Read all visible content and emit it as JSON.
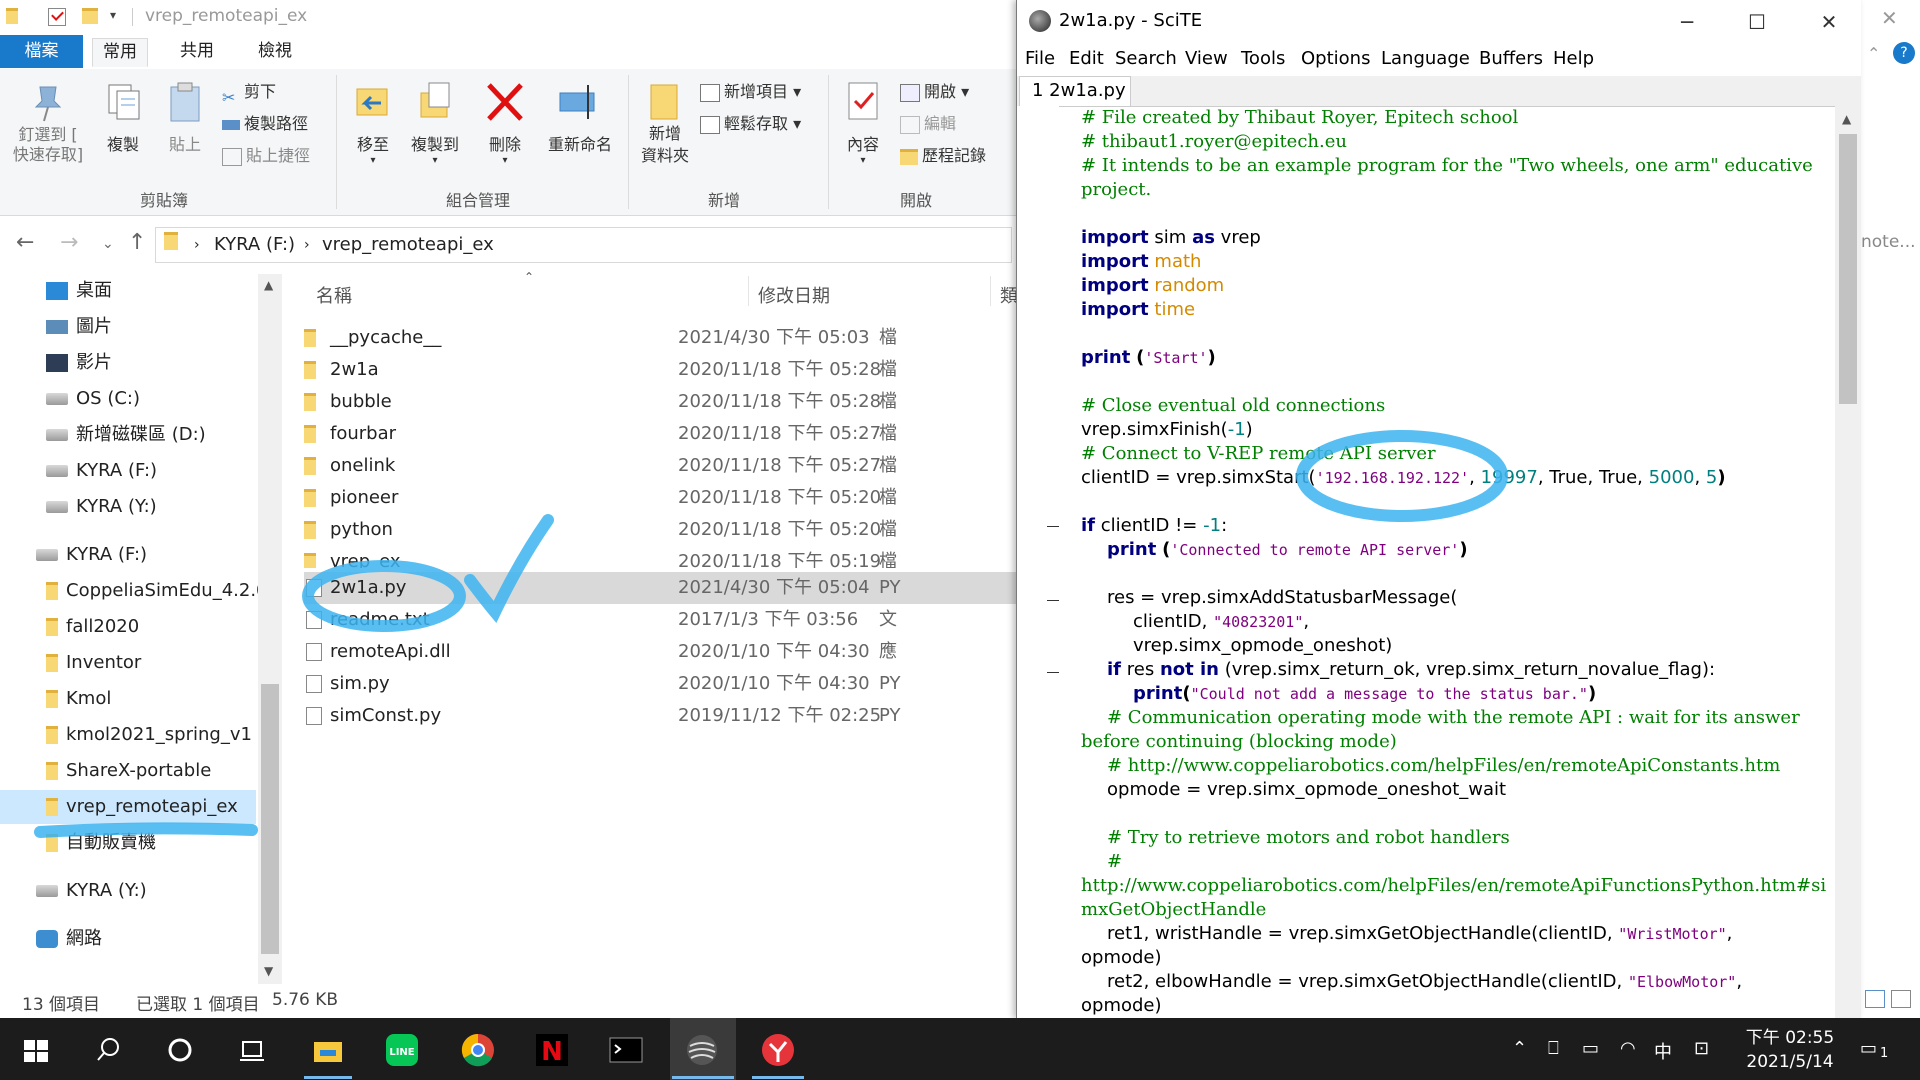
{
  "explorer": {
    "title": "vrep_remoteapi_ex",
    "tabs": [
      "檔案",
      "常用",
      "共用",
      "檢視"
    ],
    "ribbon": {
      "pin_label_1": "釘選到 [",
      "pin_label_2": "快速存取]",
      "copy": "複製",
      "paste": "貼上",
      "cut": "剪下",
      "copy_path": "複製路徑",
      "paste_shortcut": "貼上捷徑",
      "clipboard_group": "剪貼簿",
      "move_to": "移至",
      "copy_to": "複製到",
      "delete": "刪除",
      "rename": "重新命名",
      "organize_group": "組合管理",
      "new_folder_1": "新增",
      "new_folder_2": "資料夾",
      "new_item": "新增項目",
      "easy_access": "輕鬆存取",
      "new_group": "新增",
      "properties": "內容",
      "open": "開啟",
      "edit": "編輯",
      "history": "歷程記錄",
      "open_group": "開啟"
    },
    "address": {
      "segment1": "KYRA (F:)",
      "segment2": "vrep_remoteapi_ex",
      "search_hint": "note..."
    },
    "nav": [
      {
        "label": "桌面"
      },
      {
        "label": "圖片"
      },
      {
        "label": "影片"
      },
      {
        "label": "OS (C:)"
      },
      {
        "label": "新增磁碟區 (D:)"
      },
      {
        "label": "KYRA (F:)"
      },
      {
        "label": "KYRA (Y:)"
      },
      {
        "label": "KYRA (F:)"
      },
      {
        "label": "CoppeliaSimEdu_4.2.0"
      },
      {
        "label": "fall2020"
      },
      {
        "label": "Inventor"
      },
      {
        "label": "Kmol"
      },
      {
        "label": "kmol2021_spring_v1"
      },
      {
        "label": "ShareX-portable"
      },
      {
        "label": "vrep_remoteapi_ex"
      },
      {
        "label": "自動販賣機"
      },
      {
        "label": "KYRA (Y:)"
      },
      {
        "label": "網路"
      }
    ],
    "columns": {
      "name": "名稱",
      "date": "修改日期",
      "type": "類"
    },
    "files": [
      {
        "name": "__pycache__",
        "date": "2021/4/30 下午 05:03",
        "type": "檔"
      },
      {
        "name": "2w1a",
        "date": "2020/11/18 下午 05:28",
        "type": "檔"
      },
      {
        "name": "bubble",
        "date": "2020/11/18 下午 05:28",
        "type": "檔"
      },
      {
        "name": "fourbar",
        "date": "2020/11/18 下午 05:27",
        "type": "檔"
      },
      {
        "name": "onelink",
        "date": "2020/11/18 下午 05:27",
        "type": "檔"
      },
      {
        "name": "pioneer",
        "date": "2020/11/18 下午 05:20",
        "type": "檔"
      },
      {
        "name": "python",
        "date": "2020/11/18 下午 05:20",
        "type": "檔"
      },
      {
        "name": "vrep_ex",
        "date": "2020/11/18 下午 05:19",
        "type": "檔"
      },
      {
        "name": "2w1a.py",
        "date": "2021/4/30 下午 05:04",
        "type": "PY"
      },
      {
        "name": "readme.txt",
        "date": "2017/1/3 下午 03:56",
        "type": "文"
      },
      {
        "name": "remoteApi.dll",
        "date": "2020/1/10 下午 04:30",
        "type": "應"
      },
      {
        "name": "sim.py",
        "date": "2020/1/10 下午 04:30",
        "type": "PY"
      },
      {
        "name": "simConst.py",
        "date": "2019/11/12 下午 02:25",
        "type": "PY"
      }
    ],
    "status": {
      "count": "13 個項目",
      "selected": "已選取 1 個項目",
      "size": "5.76 KB"
    }
  },
  "scite": {
    "title": "2w1a.py - SciTE",
    "menu": [
      "File",
      "Edit",
      "Search",
      "View",
      "Tools",
      "Options",
      "Language",
      "Buffers",
      "Help"
    ],
    "tab": "1 2w1a.py",
    "code": {
      "c1": "# File created by Thibaut Royer, Epitech school",
      "c2": "# thibaut1.royer@epitech.eu",
      "c3": "# It intends to be an example program for the \"Two wheels, one arm\" educative",
      "c3b": "project.",
      "imp1_kw": "import",
      "imp1_a": "sim",
      "imp1_as": "as",
      "imp1_b": "vrep",
      "imp2": "math",
      "imp3": "random",
      "imp4": "time",
      "print_kw": "print",
      "start_str": "'Start'",
      "c_close": "# Close eventual old connections",
      "finish_a": "vrep.simxFinish(",
      "finish_n": "-1",
      "finish_b": ")",
      "c_connect": "# Connect to V-REP remote API server",
      "cid_a": "clientID = vrep.simxStart(",
      "ip": "'192.168.192.122'",
      "port": "19997",
      "cid_mid": ", True, True, ",
      "timeout": "5000",
      "cycle": "5",
      "if_kw": "if",
      "if_cond": "clientID != ",
      "if_n": "-1",
      "if_colon": ":",
      "connected_str": "'Connected to remote API server'",
      "res_a": "res = vrep.simxAddStatusbarMessage(",
      "res_b": "clientID, ",
      "res_num_str": "\"40823201\"",
      "res_c": "vrep.simx_opmode_oneshot)",
      "if2_a": "res ",
      "if2_not": "not in",
      "if2_b": " (vrep.simx_return_ok, vrep.simx_return_novalue_flag):",
      "err_str": "\"Could not add a message to the status bar.\"",
      "c_comm1": "# Communication operating mode with the remote API : wait for its answer",
      "c_comm2": "before continuing (blocking mode)",
      "c_url1": "# http://www.coppeliarobotics.com/helpFiles/en/remoteApiConstants.htm",
      "opmode": "opmode = vrep.simx_opmode_oneshot_wait",
      "c_try": "# Try to retrieve motors and robot handlers",
      "c_hash": "#",
      "c_url2a": "http://www.coppeliarobotics.com/helpFiles/en/remoteApiFunctionsPython.htm#si",
      "c_url2b": "mxGetObjectHandle",
      "ret1_a": "ret1, wristHandle = vrep.simxGetObjectHandle(clientID, ",
      "ret1_s": "\"WristMotor\"",
      "ret1_b": ",",
      "opm_close": "opmode)",
      "ret2_a": "ret2, elbowHandle = vrep.simxGetObjectHandle(clientID, ",
      "ret2_s": "\"ElbowMotor\"",
      "ret2_b": ","
    }
  },
  "taskbar": {
    "time": "下午 02:55",
    "date": "2021/5/14",
    "ime": "中",
    "notif_count": "1"
  },
  "colors": {
    "accent": "#1979ca",
    "annotation": "#3cb4f0",
    "comment": "#007f00",
    "keyword": "#00007f",
    "string": "#7f007f",
    "number": "#007f7f",
    "module": "#d48a00"
  }
}
